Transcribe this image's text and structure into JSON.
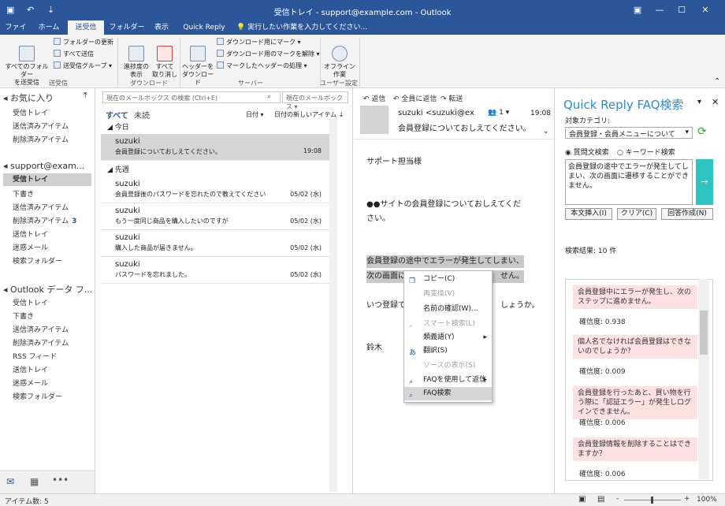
{
  "titlebar": {
    "title": "受信トレイ - support@example.com - Outlook",
    "undo": "↶",
    "qat_arrow": "⇣"
  },
  "menu": {
    "tabs": [
      "ファイル",
      "ホーム",
      "送受信",
      "フォルダー",
      "表示",
      "Quick Reply"
    ],
    "tell": "💡 実行したい作業を入力してください..."
  },
  "ribbon": {
    "send_all": "すべてのフォルダー\nを送受信",
    "update_folder": "フォルダーの更新",
    "send_all_small": "すべて送信",
    "sr_groups": "送受信グループ ▾",
    "group_sendrecv": "送受信",
    "progress": "進捗度の\n表示",
    "cancel_all": "すべて\n取り消し",
    "group_download": "ダウンロード",
    "headers": "ヘッダーを\nダウンロード",
    "mark_dl": "ダウンロード用にマーク ▾",
    "unmark_dl": "ダウンロード用のマークを解除 ▾",
    "process_marked": "マークしたヘッダーの処理 ▾",
    "group_server": "サーバー",
    "offline": "オフライン\n作業",
    "group_pref": "ユーザー設定"
  },
  "nav": {
    "favorites": "お気に入り",
    "fav_items": [
      "受信トレイ",
      "送信済みアイテム",
      "削除済みアイテム"
    ],
    "account": "support@exam...",
    "acct_items": [
      "受信トレイ",
      "下書き",
      "送信済みアイテム",
      "削除済みアイテム",
      "送信トレイ",
      "迷惑メール",
      "検索フォルダー"
    ],
    "deleted_count": "3",
    "datafile": "Outlook データ フ...",
    "data_items": [
      "受信トレイ",
      "下書き",
      "送信済みアイテム",
      "削除済みアイテム",
      "RSS フィード",
      "送信トレイ",
      "迷惑メール",
      "検索フォルダー"
    ]
  },
  "list": {
    "search_placeholder": "現在のメールボックス の検索 (Ctrl+E)",
    "scope": "現在のメールボックス",
    "tab_all": "すべて",
    "tab_unread": "未読",
    "sort_date": "日付 ▾",
    "sort_order": "日付の新しいアイテム ↓",
    "group_today": "◢ 今日",
    "group_lastweek": "◢ 先週",
    "items": [
      {
        "from": "suzuki",
        "subject": "会員登録についておしえてください。",
        "date": "19:08"
      },
      {
        "from": "suzuki",
        "subject": "会員登録後のパスワードを忘れたので教えてください",
        "date": "05/02 (水)"
      },
      {
        "from": "suzuki",
        "subject": "もう一度同じ商品を購入したいのですが",
        "date": "05/02 (水)"
      },
      {
        "from": "suzuki",
        "subject": "購入した商品が届きません。",
        "date": "05/02 (水)"
      },
      {
        "from": "suzuki",
        "subject": "パスワードを忘れました。",
        "date": "05/02 (水)"
      }
    ]
  },
  "reading": {
    "reply": "返信",
    "reply_all": "全員に返信",
    "forward": "転送",
    "sender": "suzuki <suzuki@ex",
    "people": "1 ▾",
    "time": "19:08",
    "subject": "会員登録についておしえてください。",
    "body1": "サポート担当様",
    "body2a": "●●サイトの会員登録についておしえてくだ",
    "body2b": "さい。",
    "body3a": "会員登録の途中でエラーが発生してしまい、",
    "body3b": "次の画面に",
    "body3c": "せん。",
    "body4a": "いつ登録で",
    "body4b": "しょうか。",
    "body5": "鈴木"
  },
  "context_menu": [
    {
      "label": "コピー(C)",
      "disabled": false,
      "icon": "copy-icon"
    },
    {
      "label": "再変換(V)",
      "disabled": true
    },
    {
      "label": "名前の確認(W)...",
      "disabled": false
    },
    {
      "label": "スマート検索(L)",
      "disabled": true,
      "icon": "search-icon"
    },
    {
      "label": "類義語(Y)",
      "disabled": false,
      "submenu": true
    },
    {
      "label": "翻訳(S)",
      "disabled": false,
      "icon": "translate-icon"
    },
    {
      "label": "ソースの表示(S)",
      "disabled": true
    },
    {
      "label": "FAQを使用して返信",
      "disabled": false,
      "submenu": true,
      "icon": "search-icon"
    },
    {
      "label": "FAQ検索",
      "disabled": false,
      "selected": true,
      "icon": "search-icon"
    }
  ],
  "faq": {
    "title": "Quick Reply FAQ検索",
    "category_label": "対象カテゴリ:",
    "category": "会員登録・会員メニューについて",
    "mode_question": "質問文検索",
    "mode_keyword": "キーワード検索",
    "query": "会員登録の途中でエラーが発生してしまい、次の画面に遷移することができません。",
    "insert": "本文挿入(I)",
    "clear": "クリア(C)",
    "compose": "回答作成(N)",
    "result_count": "検索結果: 10 件",
    "results": [
      {
        "q": "会員登録中にエラーが発生し、次のステップに進めません。",
        "conf": "確信度: 0.938"
      },
      {
        "q": "個人名でなければ会員登録はできないのでしょうか？",
        "conf": "確信度: 0.009"
      },
      {
        "q": "会員登録を行ったあと、買い物を行う際に「認証エラー」が発生しログインできません。",
        "conf": "確信度: 0.006"
      },
      {
        "q": "会員登録情報を削除することはできますか？",
        "conf": "確信度: 0.006"
      }
    ]
  },
  "status": {
    "items": "アイテム数: 5",
    "zoom": "100%",
    "minus": "-",
    "plus": "+"
  }
}
